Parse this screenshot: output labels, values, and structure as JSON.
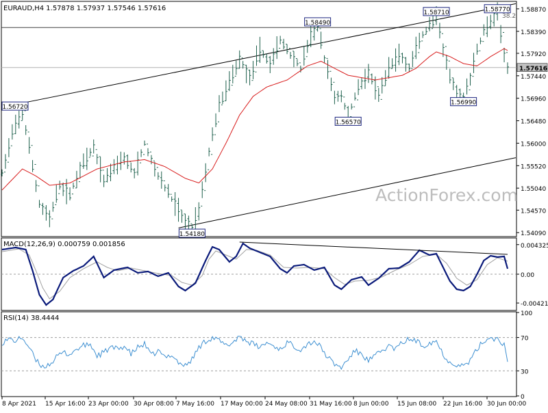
{
  "colors": {
    "background": "#ffffff",
    "frame": "#000000",
    "bars": "#1b5e4a",
    "ma": "#d81b1b",
    "channel": "#000000",
    "hline": "#404040",
    "macd_line": "#0a1a7a",
    "macd_signal": "#a0a0a0",
    "rsi": "#3d8fd1",
    "label_border": "#1a237e",
    "label_text": "#000000",
    "current_price_bg": "#c0c0c0",
    "watermark": "#bdbdbd"
  },
  "watermark": "ActionForex.com",
  "chart_data": [
    {
      "type": "ohlc",
      "title": "EURAUD,H4  1.57878 1.57937 1.57546 1.57616",
      "symbol": "EURAUD",
      "timeframe": "H4",
      "ohlc_last": {
        "open": 1.57878,
        "high": 1.57937,
        "low": 1.57546,
        "close": 1.57616
      },
      "y_ticks": [
        "1.58870",
        "1.58390",
        "1.57920",
        "1.57440",
        "1.56960",
        "1.56480",
        "1.56000",
        "1.55520",
        "1.55040",
        "1.54570",
        "1.54090"
      ],
      "ylim": [
        1.5402,
        1.59
      ],
      "current_price": "1.57616",
      "x_ticks": [
        "8 Apr 2021",
        "15 Apr 16:00",
        "23 Apr 00:00",
        "30 Apr 08:00",
        "7 May 16:00",
        "17 May 00:00",
        "24 May 08:00",
        "31 May 16:00",
        "8 Jun 00:00",
        "15 Jun 08:00",
        "22 Jun 16:00",
        "30 Jun 00:00"
      ],
      "price_path": [
        [
          0,
          1.5535
        ],
        [
          3,
          1.562
        ],
        [
          6,
          1.5665
        ],
        [
          8,
          1.559
        ],
        [
          11,
          1.547
        ],
        [
          14,
          1.544
        ],
        [
          17,
          1.551
        ],
        [
          20,
          1.549
        ],
        [
          23,
          1.5545
        ],
        [
          27,
          1.559
        ],
        [
          30,
          1.552
        ],
        [
          33,
          1.555
        ],
        [
          36,
          1.557
        ],
        [
          39,
          1.5535
        ],
        [
          42,
          1.56
        ],
        [
          45,
          1.5545
        ],
        [
          48,
          1.5505
        ],
        [
          51,
          1.547
        ],
        [
          54,
          1.543
        ],
        [
          56,
          1.5418
        ],
        [
          58,
          1.546
        ],
        [
          60,
          1.554
        ],
        [
          62,
          1.562
        ],
        [
          64,
          1.568
        ],
        [
          67,
          1.573
        ],
        [
          70,
          1.578
        ],
        [
          73,
          1.574
        ],
        [
          76,
          1.58
        ],
        [
          79,
          1.577
        ],
        [
          82,
          1.582
        ],
        [
          85,
          1.579
        ],
        [
          88,
          1.576
        ],
        [
          91,
          1.583
        ],
        [
          93,
          1.5849
        ],
        [
          95,
          1.578
        ],
        [
          98,
          1.57
        ],
        [
          100,
          1.57
        ],
        [
          102,
          1.5657
        ],
        [
          105,
          1.572
        ],
        [
          108,
          1.575
        ],
        [
          111,
          1.57
        ],
        [
          114,
          1.576
        ],
        [
          117,
          1.579
        ],
        [
          120,
          1.576
        ],
        [
          123,
          1.582
        ],
        [
          126,
          1.585
        ],
        [
          128,
          1.5871
        ],
        [
          130,
          1.58
        ],
        [
          132,
          1.574
        ],
        [
          134,
          1.571
        ],
        [
          136,
          1.5699
        ],
        [
          138,
          1.574
        ],
        [
          140,
          1.58
        ],
        [
          142,
          1.584
        ],
        [
          144,
          1.586
        ],
        [
          146,
          1.5877
        ],
        [
          148,
          1.579
        ],
        [
          149,
          1.5762
        ]
      ],
      "ma_path": [
        [
          0,
          1.55
        ],
        [
          6,
          1.5545
        ],
        [
          10,
          1.553
        ],
        [
          14,
          1.551
        ],
        [
          20,
          1.5515
        ],
        [
          28,
          1.5545
        ],
        [
          36,
          1.556
        ],
        [
          42,
          1.5565
        ],
        [
          48,
          1.555
        ],
        [
          54,
          1.5525
        ],
        [
          58,
          1.5515
        ],
        [
          62,
          1.5545
        ],
        [
          66,
          1.56
        ],
        [
          70,
          1.566
        ],
        [
          74,
          1.57
        ],
        [
          78,
          1.572
        ],
        [
          84,
          1.5735
        ],
        [
          90,
          1.5765
        ],
        [
          94,
          1.5775
        ],
        [
          98,
          1.576
        ],
        [
          102,
          1.5745
        ],
        [
          106,
          1.574
        ],
        [
          110,
          1.5735
        ],
        [
          114,
          1.574
        ],
        [
          118,
          1.5745
        ],
        [
          122,
          1.576
        ],
        [
          126,
          1.5785
        ],
        [
          128,
          1.5795
        ],
        [
          132,
          1.5785
        ],
        [
          136,
          1.577
        ],
        [
          140,
          1.5765
        ],
        [
          144,
          1.5785
        ],
        [
          148,
          1.5802
        ],
        [
          149,
          1.5798
        ]
      ],
      "channel_upper": [
        [
          0,
          1.5677
        ],
        [
          149,
          1.5898
        ]
      ],
      "channel_lower": [
        [
          52,
          1.5419
        ],
        [
          149,
          1.5569
        ]
      ],
      "hline_level": 1.5847,
      "price_labels": [
        {
          "text": "1.56720",
          "x": 0,
          "y": 1.5672,
          "anchor": "left"
        },
        {
          "text": "1.58490",
          "x": 93,
          "y": 1.5849,
          "anchor": "center-above"
        },
        {
          "text": "1.58710",
          "x": 128,
          "y": 1.5871,
          "anchor": "center-above"
        },
        {
          "text": "1.58770",
          "x": 146,
          "y": 1.5877,
          "anchor": "center-above"
        },
        {
          "text": "1.56570",
          "x": 102,
          "y": 1.5657,
          "anchor": "center-below"
        },
        {
          "text": "1.56990",
          "x": 136,
          "y": 1.5699,
          "anchor": "center-below"
        },
        {
          "text": "1.54180",
          "x": 56,
          "y": 1.5418,
          "anchor": "center-below"
        }
      ],
      "fib_label": "38.2"
    },
    {
      "type": "line",
      "title": "MACD(12,26,9) 0.000759 0.001856",
      "y_ticks": [
        "0.004325",
        "0.00",
        "-0.004213"
      ],
      "ylim": [
        -0.0052,
        0.0052
      ],
      "macd_path": [
        [
          0,
          0.0036
        ],
        [
          4,
          0.0039
        ],
        [
          7,
          0.0036
        ],
        [
          9,
          0.0005
        ],
        [
          11,
          -0.003
        ],
        [
          13,
          -0.0045
        ],
        [
          15,
          -0.0037
        ],
        [
          18,
          -0.0005
        ],
        [
          21,
          0.0005
        ],
        [
          24,
          0.0012
        ],
        [
          27,
          0.0026
        ],
        [
          30,
          -0.0005
        ],
        [
          33,
          0.0006
        ],
        [
          37,
          0.001
        ],
        [
          40,
          0.0002
        ],
        [
          43,
          0.0004
        ],
        [
          46,
          -0.0003
        ],
        [
          49,
          0.0002
        ],
        [
          52,
          -0.0018
        ],
        [
          54,
          -0.0024
        ],
        [
          57,
          -0.0013
        ],
        [
          60,
          0.002
        ],
        [
          62,
          0.004
        ],
        [
          64,
          0.0036
        ],
        [
          67,
          0.0018
        ],
        [
          69,
          0.0026
        ],
        [
          71,
          0.0045
        ],
        [
          73,
          0.0038
        ],
        [
          76,
          0.0032
        ],
        [
          79,
          0.0026
        ],
        [
          82,
          0.0008
        ],
        [
          84,
          0.0002
        ],
        [
          86,
          0.0012
        ],
        [
          89,
          0.0014
        ],
        [
          92,
          0.0006
        ],
        [
          95,
          0.001
        ],
        [
          98,
          -0.0016
        ],
        [
          100,
          -0.0022
        ],
        [
          103,
          -0.0008
        ],
        [
          106,
          -0.0004
        ],
        [
          108,
          -0.0016
        ],
        [
          111,
          -0.0006
        ],
        [
          114,
          0.0008
        ],
        [
          117,
          0.0009
        ],
        [
          120,
          0.0018
        ],
        [
          123,
          0.0035
        ],
        [
          126,
          0.0028
        ],
        [
          128,
          0.003
        ],
        [
          130,
          0.001
        ],
        [
          132,
          -0.001
        ],
        [
          134,
          -0.0022
        ],
        [
          136,
          -0.0024
        ],
        [
          138,
          -0.0018
        ],
        [
          140,
          0.0
        ],
        [
          142,
          0.002
        ],
        [
          144,
          0.0027
        ],
        [
          146,
          0.0025
        ],
        [
          148,
          0.0026
        ],
        [
          149,
          0.0008
        ]
      ],
      "signal_path": [
        [
          0,
          0.0033
        ],
        [
          5,
          0.0037
        ],
        [
          8,
          0.0028
        ],
        [
          10,
          0.0005
        ],
        [
          12,
          -0.002
        ],
        [
          14,
          -0.0036
        ],
        [
          17,
          -0.0025
        ],
        [
          20,
          -0.0005
        ],
        [
          24,
          0.0008
        ],
        [
          28,
          0.0018
        ],
        [
          31,
          0.001
        ],
        [
          34,
          0.0005
        ],
        [
          38,
          0.0009
        ],
        [
          42,
          0.0005
        ],
        [
          46,
          0.0001
        ],
        [
          50,
          -0.0002
        ],
        [
          53,
          -0.0012
        ],
        [
          56,
          -0.0016
        ],
        [
          59,
          -0.0002
        ],
        [
          61,
          0.0022
        ],
        [
          63,
          0.0034
        ],
        [
          66,
          0.0028
        ],
        [
          69,
          0.0022
        ],
        [
          72,
          0.0036
        ],
        [
          75,
          0.0035
        ],
        [
          79,
          0.0028
        ],
        [
          83,
          0.001
        ],
        [
          87,
          0.0009
        ],
        [
          91,
          0.001
        ],
        [
          95,
          0.0008
        ],
        [
          98,
          -0.0005
        ],
        [
          101,
          -0.0015
        ],
        [
          104,
          -0.001
        ],
        [
          108,
          -0.0009
        ],
        [
          112,
          -0.0004
        ],
        [
          116,
          0.0006
        ],
        [
          120,
          0.0014
        ],
        [
          124,
          0.0026
        ],
        [
          128,
          0.0029
        ],
        [
          131,
          0.0016
        ],
        [
          134,
          -0.0006
        ],
        [
          137,
          -0.0016
        ],
        [
          140,
          -0.0008
        ],
        [
          143,
          0.0014
        ],
        [
          146,
          0.0024
        ],
        [
          149,
          0.0019
        ]
      ],
      "trendline": [
        [
          70,
          0.0047
        ],
        [
          149,
          0.0029
        ]
      ]
    },
    {
      "type": "line",
      "title": "RSI(14) 38.4444",
      "y_ticks": [
        "100",
        "70",
        "30",
        "0"
      ],
      "ylim": [
        0,
        100
      ],
      "levels": [
        70,
        30
      ],
      "rsi_path": [
        [
          0,
          64
        ],
        [
          2,
          68
        ],
        [
          4,
          66
        ],
        [
          6,
          70
        ],
        [
          8,
          58
        ],
        [
          10,
          42
        ],
        [
          12,
          35
        ],
        [
          14,
          38
        ],
        [
          16,
          46
        ],
        [
          18,
          52
        ],
        [
          20,
          50
        ],
        [
          22,
          56
        ],
        [
          24,
          60
        ],
        [
          26,
          62
        ],
        [
          28,
          48
        ],
        [
          30,
          52
        ],
        [
          32,
          58
        ],
        [
          34,
          56
        ],
        [
          36,
          60
        ],
        [
          38,
          50
        ],
        [
          40,
          58
        ],
        [
          42,
          62
        ],
        [
          44,
          48
        ],
        [
          46,
          54
        ],
        [
          48,
          46
        ],
        [
          50,
          50
        ],
        [
          52,
          40
        ],
        [
          54,
          36
        ],
        [
          56,
          44
        ],
        [
          58,
          58
        ],
        [
          60,
          66
        ],
        [
          62,
          70
        ],
        [
          64,
          66
        ],
        [
          66,
          60
        ],
        [
          68,
          64
        ],
        [
          70,
          72
        ],
        [
          72,
          66
        ],
        [
          74,
          62
        ],
        [
          76,
          58
        ],
        [
          78,
          64
        ],
        [
          80,
          60
        ],
        [
          82,
          56
        ],
        [
          84,
          64
        ],
        [
          86,
          60
        ],
        [
          88,
          56
        ],
        [
          90,
          62
        ],
        [
          92,
          66
        ],
        [
          94,
          58
        ],
        [
          96,
          46
        ],
        [
          98,
          38
        ],
        [
          100,
          34
        ],
        [
          102,
          44
        ],
        [
          104,
          54
        ],
        [
          106,
          50
        ],
        [
          108,
          42
        ],
        [
          110,
          48
        ],
        [
          112,
          54
        ],
        [
          114,
          60
        ],
        [
          116,
          56
        ],
        [
          118,
          64
        ],
        [
          120,
          68
        ],
        [
          122,
          66
        ],
        [
          124,
          60
        ],
        [
          126,
          64
        ],
        [
          128,
          66
        ],
        [
          130,
          50
        ],
        [
          132,
          40
        ],
        [
          134,
          38
        ],
        [
          136,
          36
        ],
        [
          138,
          42
        ],
        [
          140,
          56
        ],
        [
          142,
          66
        ],
        [
          144,
          70
        ],
        [
          146,
          68
        ],
        [
          148,
          62
        ],
        [
          149,
          38
        ]
      ]
    }
  ]
}
